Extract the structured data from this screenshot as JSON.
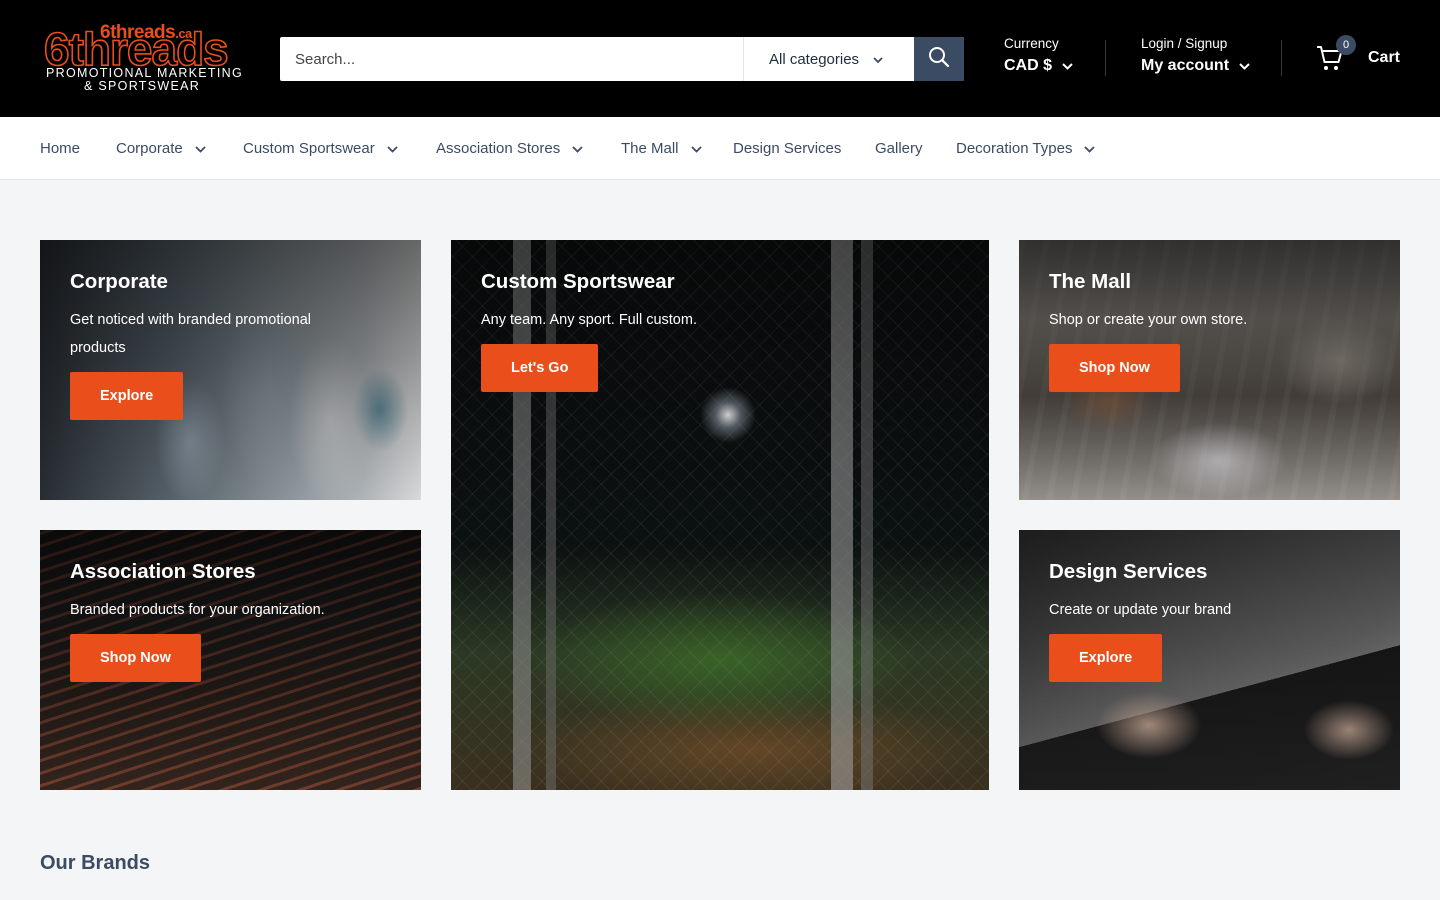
{
  "logo": {
    "top": "6threads",
    "top_suffix": ".ca",
    "main": "6threads",
    "line1": "PROMOTIONAL MARKETING",
    "line2": "& SPORTSWEAR"
  },
  "search": {
    "placeholder": "Search...",
    "category_label": "All categories",
    "button_icon": "search-icon"
  },
  "currency": {
    "label": "Currency",
    "value": "CAD $"
  },
  "account": {
    "label": "Login / Signup",
    "value": "My account"
  },
  "cart": {
    "count": "0",
    "label": "Cart",
    "icon": "cart-icon"
  },
  "nav": {
    "items": [
      {
        "label": "Home",
        "has_dropdown": false
      },
      {
        "label": "Corporate",
        "has_dropdown": true
      },
      {
        "label": "Custom Sportswear",
        "has_dropdown": true
      },
      {
        "label": "Association Stores",
        "has_dropdown": true
      },
      {
        "label": "The Mall",
        "has_dropdown": true
      },
      {
        "label": "Design Services",
        "has_dropdown": false
      },
      {
        "label": "Gallery",
        "has_dropdown": false
      },
      {
        "label": "Decoration Types",
        "has_dropdown": true
      }
    ]
  },
  "tiles": {
    "corporate": {
      "title": "Corporate",
      "text": "Get noticed with branded promotional products",
      "button": "Explore"
    },
    "sportswear": {
      "title": "Custom Sportswear",
      "text": "Any team. Any sport. Full custom.",
      "button": "Let's Go"
    },
    "mall": {
      "title": "The Mall",
      "text": "Shop or create your own store.",
      "button": "Shop Now"
    },
    "association": {
      "title": "Association Stores",
      "text": "Branded products for your organization.",
      "button": "Shop Now"
    },
    "design": {
      "title": "Design Services",
      "text": "Create or update your brand",
      "button": "Explore"
    }
  },
  "brands_heading": "Our Brands",
  "colors": {
    "header_bg": "#000000",
    "accent": "#e94e1b",
    "navy": "#3c4b64",
    "page_bg": "#f3f5f7"
  }
}
